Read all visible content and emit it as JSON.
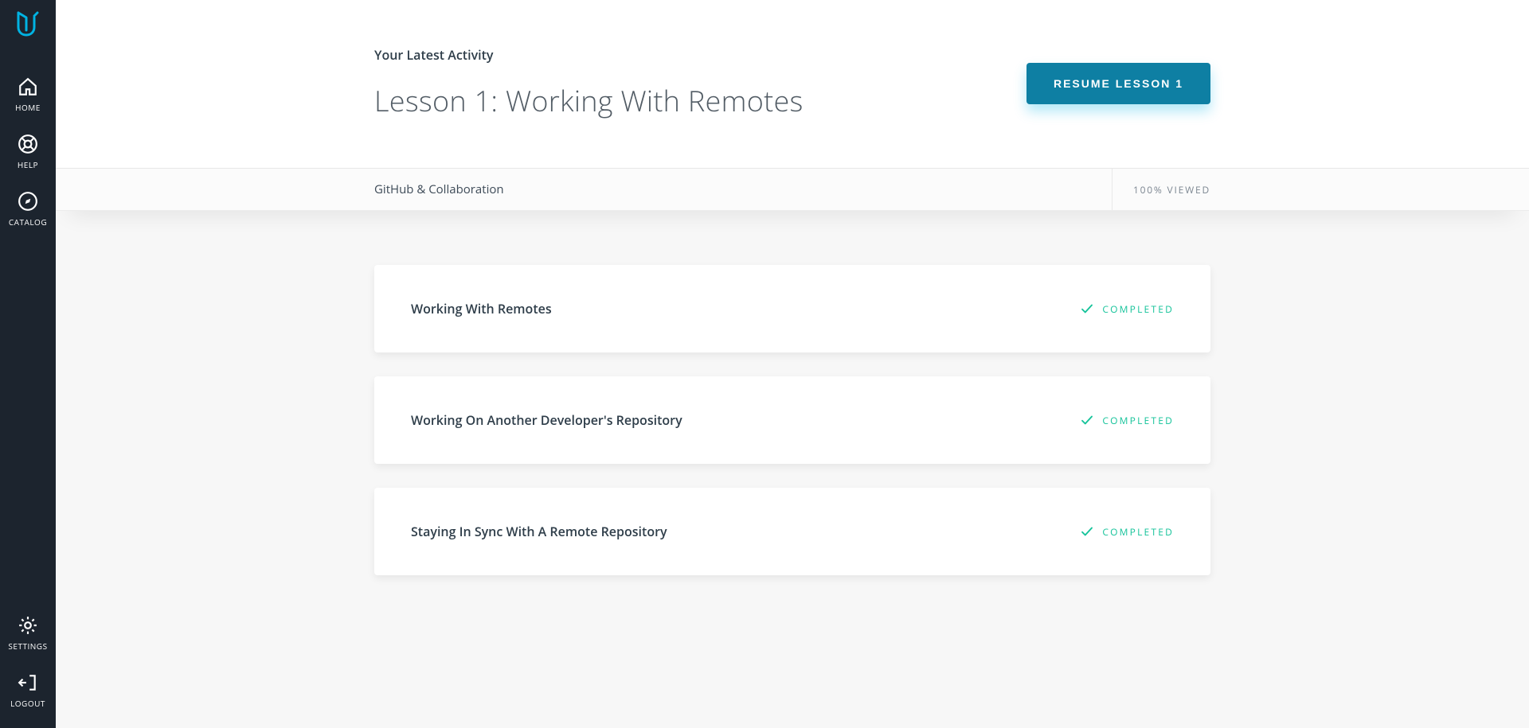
{
  "sidebar": {
    "items": [
      {
        "label": "HOME"
      },
      {
        "label": "HELP"
      },
      {
        "label": "CATALOG"
      }
    ],
    "bottomItems": [
      {
        "label": "SETTINGS"
      },
      {
        "label": "LOGOUT"
      }
    ]
  },
  "hero": {
    "activity_label": "Your Latest Activity",
    "lesson_title": "Lesson 1: Working With Remotes",
    "resume_label": "RESUME LESSON 1"
  },
  "subheader": {
    "course_name": "GitHub & Collaboration",
    "viewed_text": "100% VIEWED"
  },
  "lessons": [
    {
      "title": "Working With Remotes",
      "status": "COMPLETED"
    },
    {
      "title": "Working On Another Developer's Repository",
      "status": "COMPLETED"
    },
    {
      "title": "Staying In Sync With A Remote Repository",
      "status": "COMPLETED"
    }
  ]
}
